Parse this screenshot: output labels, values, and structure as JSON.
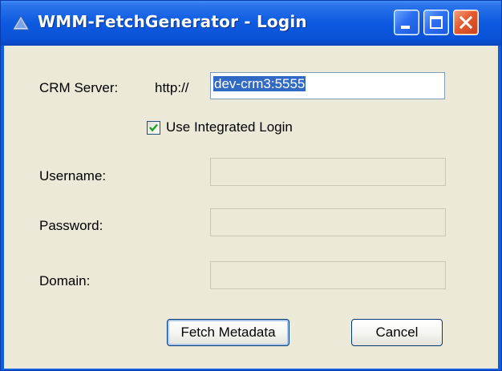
{
  "window": {
    "title": "WMM-FetchGenerator - Login"
  },
  "form": {
    "crm_server_label": "CRM Server:",
    "protocol_prefix": "http://",
    "crm_server_value": "dev-crm3:5555",
    "use_integrated_login_label": "Use Integrated Login",
    "use_integrated_login_checked": true,
    "username_label": "Username:",
    "username_value": "",
    "password_label": "Password:",
    "password_value": "",
    "domain_label": "Domain:",
    "domain_value": ""
  },
  "buttons": {
    "fetch_metadata": "Fetch Metadata",
    "cancel": "Cancel"
  },
  "icons": {
    "title_icon": "triangle-app-icon",
    "minimize": "minimize-icon",
    "maximize": "maximize-icon",
    "close": "close-icon",
    "check": "checkmark-icon"
  },
  "colors": {
    "titlebar": "#0b5fe0",
    "client_bg": "#ece9d8",
    "selection": "#316ac5",
    "close_button": "#e25b2f",
    "checkmark": "#21a121"
  }
}
